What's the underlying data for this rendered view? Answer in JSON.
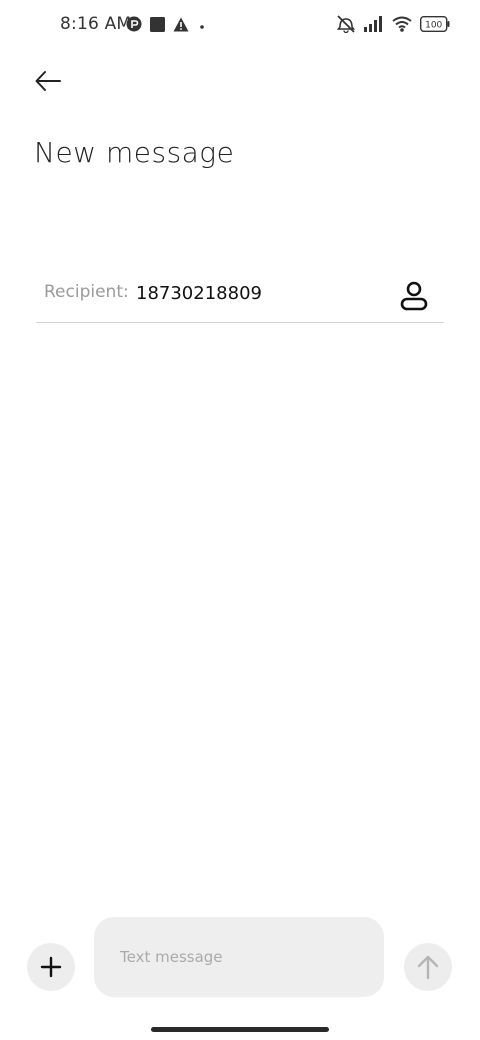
{
  "status_bar": {
    "time": "8:16 AM",
    "battery": "100",
    "left_icons": [
      "app-notification-icon",
      "square-notification-icon",
      "warning-icon",
      "dot-icon"
    ],
    "right_icons": [
      "mute-icon",
      "signal-icon",
      "wifi-icon",
      "battery-icon"
    ]
  },
  "header": {
    "back_icon": "back-arrow-icon",
    "title": "New message"
  },
  "recipient": {
    "label": "Recipient:",
    "value": "18730218809",
    "contact_icon": "contact-person-icon"
  },
  "composer": {
    "add_icon": "plus-icon",
    "placeholder": "Text message",
    "send_icon": "send-arrow-up-icon"
  },
  "colors": {
    "background": "#ffffff",
    "input_bg": "#eeeeee",
    "divider": "#d4d4d4",
    "muted_text": "#9a9a9a"
  }
}
